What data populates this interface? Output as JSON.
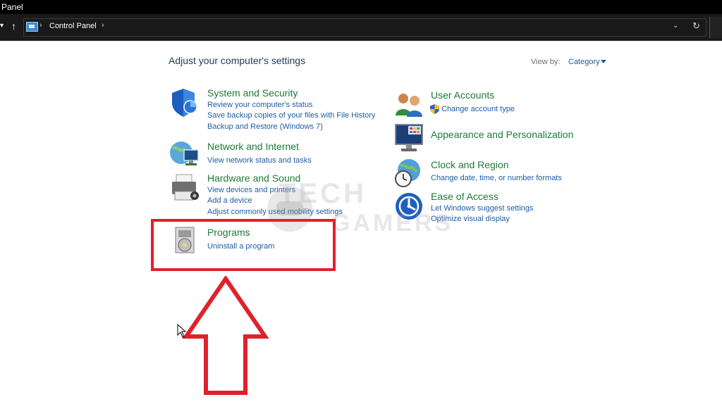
{
  "window": {
    "title_fragment": "Panel"
  },
  "address_bar": {
    "breadcrumb": "Control Panel"
  },
  "main": {
    "heading": "Adjust your computer's settings",
    "view_by_label": "View by:",
    "view_by_value": "Category"
  },
  "left_categories": [
    {
      "title": "System and Security",
      "links": [
        "Review your computer's status",
        "Save backup copies of your files with File History",
        "Backup and Restore (Windows 7)"
      ]
    },
    {
      "title": "Network and Internet",
      "links": [
        "View network status and tasks"
      ]
    },
    {
      "title": "Hardware and Sound",
      "links": [
        "View devices and printers",
        "Add a device",
        "Adjust commonly used mobility settings"
      ]
    },
    {
      "title": "Programs",
      "links": [
        "Uninstall a program"
      ]
    }
  ],
  "right_categories": [
    {
      "title": "User Accounts",
      "links": [
        "Change account type"
      ]
    },
    {
      "title": "Appearance and Personalization",
      "links": []
    },
    {
      "title": "Clock and Region",
      "links": [
        "Change date, time, or number formats"
      ]
    },
    {
      "title": "Ease of Access",
      "links": [
        "Let Windows suggest settings",
        "Optimize visual display"
      ]
    }
  ],
  "overlay": {
    "watermark_line1": "TECH",
    "watermark_line2": "GAMERS",
    "highlight_color": "#e0212b"
  }
}
